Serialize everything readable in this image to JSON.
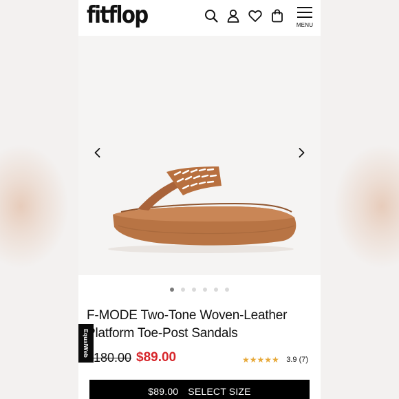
{
  "header": {
    "logo": "fitflop",
    "menu_label": "MENU",
    "icons": [
      "search-icon",
      "account-icon",
      "wishlist-icon",
      "bag-icon",
      "menu-icon"
    ]
  },
  "gallery": {
    "slide_count": 6,
    "active_slide": 1,
    "icons": [
      "chevron-left-icon",
      "chevron-right-icon"
    ]
  },
  "product": {
    "title_line1": "F-MODE Two-Tone Woven-Leather",
    "title_line2": "Platform Toe-Post Sandals",
    "old_price": "$180.00",
    "new_price": "$89.00",
    "rating_stars": 3.9,
    "rating_text": "3.9 (7)"
  },
  "cta": {
    "price": "$89.00",
    "label": "SELECT SIZE"
  },
  "accessibility_tab": {
    "label": "EqualWeb"
  },
  "colors": {
    "accent_sale": "#d7272c",
    "star": "#e7a93a",
    "cta_bg": "#000000",
    "sandal": "#b8703f"
  }
}
